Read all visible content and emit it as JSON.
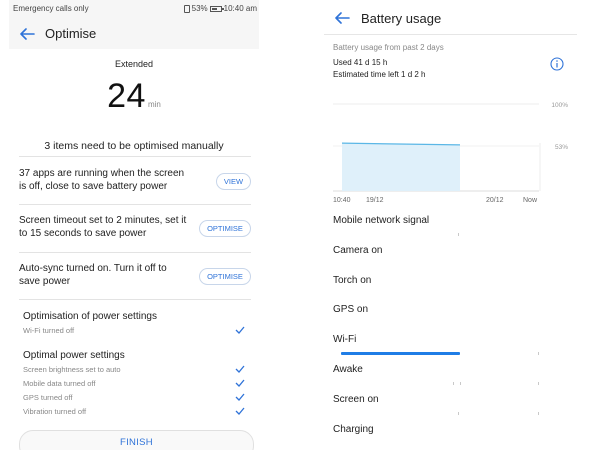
{
  "optimise_screen": {
    "status_bar": {
      "left_text": "Emergency calls only",
      "battery_percent": "53%",
      "time": "10:40 am"
    },
    "header": {
      "title": "Optimise",
      "back_icon": "back-arrow-icon"
    },
    "summary": {
      "mode_label": "Extended",
      "big_number": "24",
      "unit": "min",
      "items_message": "3 items need to be optimised manually"
    },
    "manual_items": [
      {
        "text": "37 apps are running when the screen is off, close to save battery power",
        "button": "VIEW"
      },
      {
        "text": "Screen timeout set to 2 minutes, set it to 15 seconds to save power",
        "button": "OPTIMISE"
      },
      {
        "text": "Auto-sync turned on. Turn it off to save power",
        "button": "OPTIMISE"
      }
    ],
    "power_settings": {
      "title": "Optimisation of power settings",
      "items": [
        {
          "label": "Wi-Fi turned off",
          "status_icon": "check-icon"
        }
      ]
    },
    "optimal_settings": {
      "title": "Optimal power settings",
      "items": [
        {
          "label": "Screen brightness set to auto",
          "status_icon": "check-icon"
        },
        {
          "label": "Mobile data turned off",
          "status_icon": "check-icon"
        },
        {
          "label": "GPS turned off",
          "status_icon": "check-icon"
        },
        {
          "label": "Vibration turned off",
          "status_icon": "check-icon"
        }
      ]
    },
    "finish_button": "FINISH"
  },
  "battery_screen": {
    "header": {
      "title": "Battery usage",
      "back_icon": "back-arrow-icon"
    },
    "usage_from": "Battery usage from past 2 days",
    "used": "Used 41 d 15 h",
    "estimated": "Estimated time left 1 d 2 h",
    "info_icon": "info-icon",
    "accent_color": "#1f7de6",
    "chart_data": {
      "type": "area",
      "x_labels": [
        "10:40",
        "19/12",
        "20/12",
        "Now"
      ],
      "y_labels": [
        "100%",
        "53%"
      ],
      "series": [
        {
          "x": [
            "10:40",
            "20/12"
          ],
          "values": [
            55,
            53
          ]
        }
      ],
      "ylim": [
        0,
        100
      ],
      "grid": true
    },
    "usage_rows": [
      {
        "label": "Mobile network signal",
        "fill": 0,
        "ticks": [
          0.55
        ]
      },
      {
        "label": "Camera on",
        "fill": 0,
        "ticks": []
      },
      {
        "label": "Torch on",
        "fill": 0,
        "ticks": []
      },
      {
        "label": "GPS on",
        "fill": 0,
        "ticks": []
      },
      {
        "label": "Wi-Fi",
        "fill": 0.56,
        "ticks": [
          0.93
        ]
      },
      {
        "label": "Awake",
        "fill": 0,
        "ticks": [
          0.53,
          0.56,
          0.93
        ]
      },
      {
        "label": "Screen on",
        "fill": 0,
        "ticks": [
          0.55,
          0.93
        ]
      },
      {
        "label": "Charging",
        "fill": 0,
        "ticks": []
      }
    ]
  }
}
